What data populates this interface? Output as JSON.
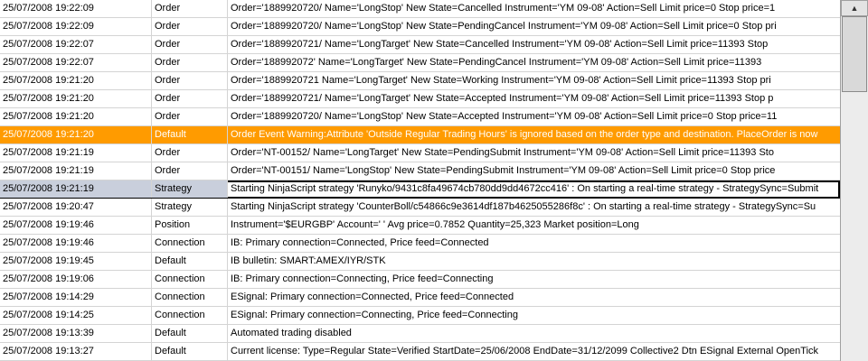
{
  "log": {
    "rows": [
      {
        "time": "25/07/2008 19:22:09",
        "category": "Order",
        "message": "Order='1889920720/                 Name='LongStop' New State=Cancelled Instrument='YM 09-08' Action=Sell Limit price=0 Stop price=1"
      },
      {
        "time": "25/07/2008 19:22:09",
        "category": "Order",
        "message": "Order='1889920720/                 Name='LongStop' New State=PendingCancel Instrument='YM 09-08' Action=Sell Limit price=0 Stop pri"
      },
      {
        "time": "25/07/2008 19:22:07",
        "category": "Order",
        "message": "Order='1889920721/                 Name='LongTarget' New State=Cancelled Instrument='YM 09-08' Action=Sell Limit price=11393 Stop"
      },
      {
        "time": "25/07/2008 19:22:07",
        "category": "Order",
        "message": "Order='188992072'                  Name='LongTarget' New State=PendingCancel Instrument='YM 09-08' Action=Sell Limit price=11393"
      },
      {
        "time": "25/07/2008 19:21:20",
        "category": "Order",
        "message": "Order='1889920721                  Name='LongTarget' New State=Working Instrument='YM 09-08' Action=Sell Limit price=11393 Stop pri"
      },
      {
        "time": "25/07/2008 19:21:20",
        "category": "Order",
        "message": "Order='1889920721/                 Name='LongTarget' New State=Accepted Instrument='YM 09-08' Action=Sell Limit price=11393 Stop p"
      },
      {
        "time": "25/07/2008 19:21:20",
        "category": "Order",
        "message": "Order='1889920720/                 Name='LongStop' New State=Accepted Instrument='YM 09-08' Action=Sell Limit price=0 Stop price=11"
      },
      {
        "time": "25/07/2008 19:21:20",
        "category": "Default",
        "message": "Order Event Warning:Attribute 'Outside Regular Trading Hours' is ignored based on the order type and destination. PlaceOrder is now",
        "type": "warn"
      },
      {
        "time": "25/07/2008 19:21:19",
        "category": "Order",
        "message": "Order='NT-00152/                   Name='LongTarget' New State=PendingSubmit Instrument='YM 09-08' Action=Sell Limit price=11393 Sto"
      },
      {
        "time": "25/07/2008 19:21:19",
        "category": "Order",
        "message": "Order='NT-00151/                   Name='LongStop' New State=PendingSubmit Instrument='YM 09-08' Action=Sell Limit price=0 Stop price"
      },
      {
        "time": "25/07/2008 19:21:19",
        "category": "Strategy",
        "message": "Starting NinjaScript strategy 'Runyko/9431c8fa49674cb780dd9dd4672cc416' : On starting a real-time strategy - StrategySync=Submit",
        "type": "sel"
      },
      {
        "time": "25/07/2008 19:20:47",
        "category": "Strategy",
        "message": "Starting NinjaScript strategy 'CounterBoll/c54866c9e3614df187b4625055286f8c' : On starting a real-time strategy - StrategySync=Su"
      },
      {
        "time": "25/07/2008 19:19:46",
        "category": "Position",
        "message": "Instrument='$EURGBP' Account='           ' Avg price=0.7852 Quantity=25,323 Market position=Long"
      },
      {
        "time": "25/07/2008 19:19:46",
        "category": "Connection",
        "message": "IB: Primary connection=Connected, Price feed=Connected"
      },
      {
        "time": "25/07/2008 19:19:45",
        "category": "Default",
        "message": "IB bulletin: SMART:AMEX/IYR/STK"
      },
      {
        "time": "25/07/2008 19:19:06",
        "category": "Connection",
        "message": "IB: Primary connection=Connecting, Price feed=Connecting"
      },
      {
        "time": "25/07/2008 19:14:29",
        "category": "Connection",
        "message": "ESignal: Primary connection=Connected, Price feed=Connected"
      },
      {
        "time": "25/07/2008 19:14:25",
        "category": "Connection",
        "message": "ESignal: Primary connection=Connecting, Price feed=Connecting"
      },
      {
        "time": "25/07/2008 19:13:39",
        "category": "Default",
        "message": "Automated trading disabled"
      },
      {
        "time": "25/07/2008 19:13:27",
        "category": "Default",
        "message": "Current license: Type=Regular State=Verified StartDate=25/06/2008 EndDate=31/12/2099 Collective2 Dtn ESignal External OpenTick"
      }
    ]
  },
  "scrollbar": {
    "up_arrow": "▲"
  }
}
